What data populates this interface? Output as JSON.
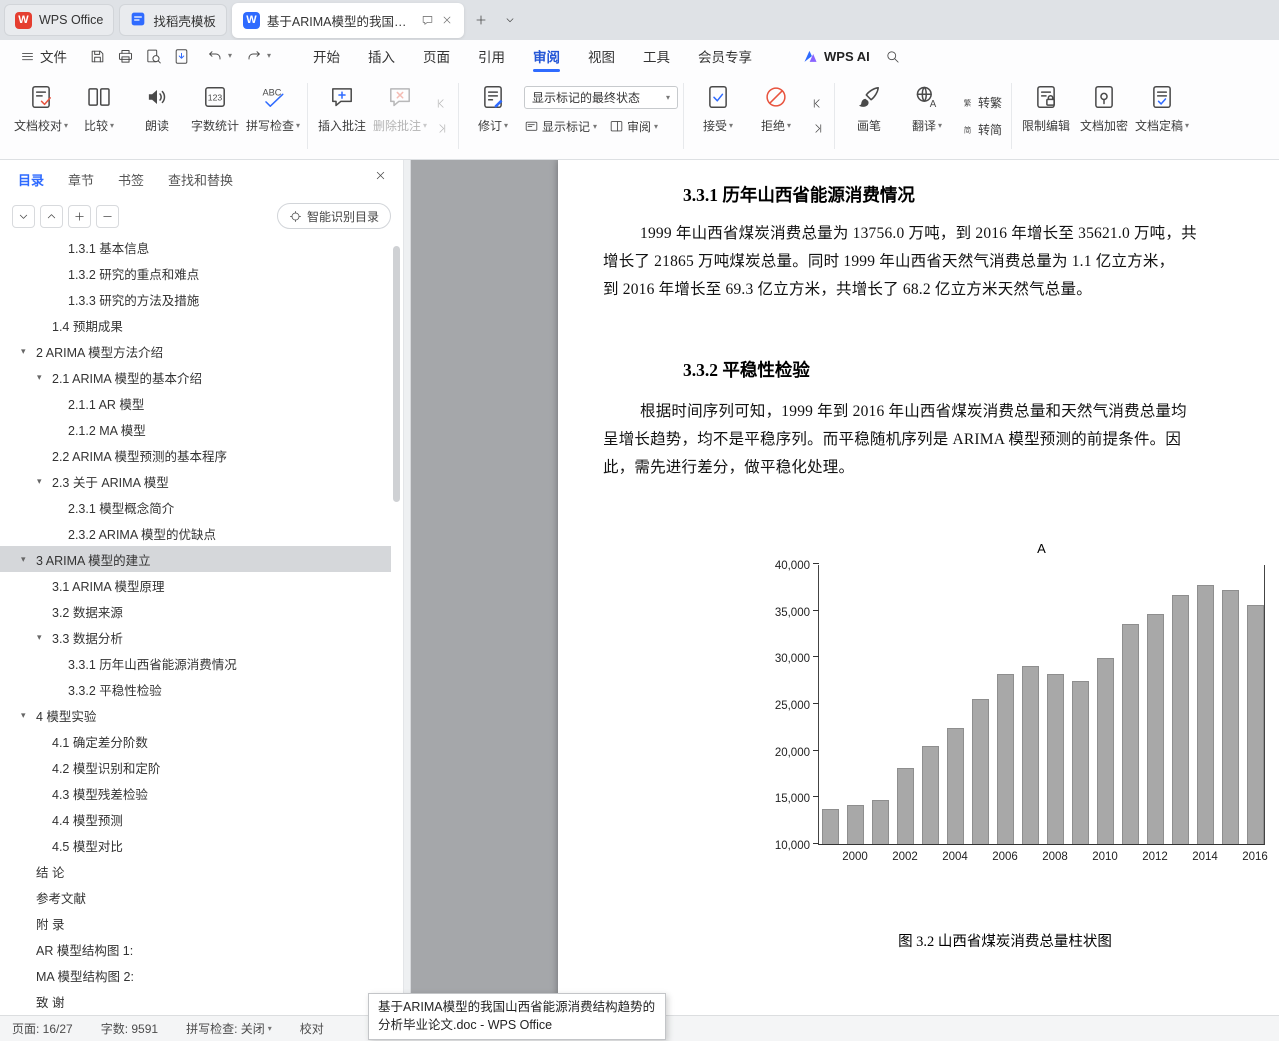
{
  "tabbar": {
    "wps_tab_label": "WPS Office",
    "tabs": [
      {
        "name": "template-store",
        "label": "找稻壳模板",
        "active": false
      },
      {
        "name": "arima-doc",
        "label": "基于ARIMA模型的我国山西省...",
        "active": true
      }
    ]
  },
  "menubar": {
    "file_label": "文件",
    "menus": [
      {
        "name": "home",
        "label": "开始",
        "active": false
      },
      {
        "name": "insert",
        "label": "插入",
        "active": false
      },
      {
        "name": "page",
        "label": "页面",
        "active": false
      },
      {
        "name": "reference",
        "label": "引用",
        "active": false
      },
      {
        "name": "review",
        "label": "审阅",
        "active": true
      },
      {
        "name": "view",
        "label": "视图",
        "active": false
      },
      {
        "name": "tools",
        "label": "工具",
        "active": false
      },
      {
        "name": "membership",
        "label": "会员专享",
        "active": false
      }
    ],
    "wps_ai_label": "WPS AI"
  },
  "ribbon": {
    "markup_state_value": "显示标记的最终状态",
    "groups": [
      {
        "items": [
          {
            "kind": "large",
            "name": "doc-proofing",
            "icon": "doc-check-icon",
            "label": "文档校对",
            "dropdown": true
          },
          {
            "kind": "large",
            "name": "compare",
            "icon": "compare-icon",
            "label": "比较",
            "dropdown": true
          },
          {
            "kind": "large",
            "name": "read-aloud",
            "icon": "speaker-icon",
            "label": "朗读",
            "dropdown": false
          },
          {
            "kind": "large",
            "name": "word-count",
            "icon": "word-count-icon",
            "label": "字数统计",
            "dropdown": false
          },
          {
            "kind": "large",
            "name": "spell-check",
            "icon": "spell-check-icon",
            "label": "拼写检查",
            "dropdown": true
          }
        ]
      },
      {
        "items": [
          {
            "kind": "large",
            "name": "insert-comment",
            "icon": "insert-comment-icon",
            "label": "插入批注",
            "dropdown": false
          },
          {
            "kind": "large",
            "name": "delete-comment",
            "icon": "delete-comment-icon",
            "label": "删除批注",
            "dropdown": true,
            "disabled": true
          },
          {
            "kind": "nav",
            "name": "comment-nav",
            "disabled": true
          }
        ]
      },
      {
        "items": [
          {
            "kind": "large",
            "name": "track-changes",
            "icon": "track-changes-icon",
            "label": "修订",
            "dropdown": true
          },
          {
            "kind": "markup-stack",
            "name": "markup-controls",
            "buttons": [
              {
                "name": "show-markup",
                "icon": "show-markup-icon",
                "label": "显示标记",
                "dropdown": true
              },
              {
                "name": "review-pane",
                "icon": "review-pane-icon",
                "label": "审阅",
                "dropdown": true
              }
            ]
          }
        ]
      },
      {
        "items": [
          {
            "kind": "large",
            "name": "accept-changes",
            "icon": "accept-icon",
            "label": "接受",
            "dropdown": true
          },
          {
            "kind": "large",
            "name": "reject-changes",
            "icon": "reject-icon",
            "label": "拒绝",
            "dropdown": true
          },
          {
            "kind": "nav",
            "name": "change-nav",
            "disabled": false
          }
        ]
      },
      {
        "items": [
          {
            "kind": "large",
            "name": "ink-brush",
            "icon": "brush-icon",
            "label": "画笔",
            "dropdown": false
          },
          {
            "kind": "large",
            "name": "translate",
            "icon": "translate-icon",
            "label": "翻译",
            "dropdown": true
          },
          {
            "kind": "small-stack",
            "name": "convert-stack",
            "buttons": [
              {
                "name": "to-traditional",
                "icon": "to-traditional-icon",
                "label": "转繁"
              },
              {
                "name": "to-simplified",
                "icon": "to-simplified-icon",
                "label": "转简"
              }
            ]
          }
        ]
      },
      {
        "items": [
          {
            "kind": "large",
            "name": "restrict-editing",
            "icon": "restrict-edit-icon",
            "label": "限制编辑",
            "dropdown": false
          },
          {
            "kind": "large",
            "name": "encrypt-document",
            "icon": "encrypt-icon",
            "label": "文档加密",
            "dropdown": false
          },
          {
            "kind": "large",
            "name": "finalize-document",
            "icon": "finalize-icon",
            "label": "文档定稿",
            "dropdown": true
          }
        ]
      }
    ]
  },
  "sidebar": {
    "tabs": [
      {
        "name": "toc",
        "label": "目录",
        "active": true
      },
      {
        "name": "chapters",
        "label": "章节",
        "active": false
      },
      {
        "name": "bookmarks",
        "label": "书签",
        "active": false
      },
      {
        "name": "find-replace",
        "label": "查找和替换",
        "active": false
      }
    ],
    "smart_toc_label": "智能识别目录",
    "toc": [
      {
        "text": "1.3.1 基本信息",
        "level": 3
      },
      {
        "text": "1.3.2 研究的重点和难点",
        "level": 3
      },
      {
        "text": "1.3.3 研究的方法及措施",
        "level": 3
      },
      {
        "text": "1.4 预期成果",
        "level": 2
      },
      {
        "text": "2 ARIMA 模型方法介绍",
        "level": 1,
        "expand": true
      },
      {
        "text": "2.1 ARIMA 模型的基本介绍",
        "level": 2,
        "expand": true
      },
      {
        "text": "2.1.1 AR 模型",
        "level": 3
      },
      {
        "text": "2.1.2 MA 模型",
        "level": 3
      },
      {
        "text": "2.2 ARIMA 模型预测的基本程序",
        "level": 2
      },
      {
        "text": "2.3 关于 ARIMA 模型",
        "level": 2,
        "expand": true
      },
      {
        "text": "2.3.1 模型概念简介",
        "level": 3
      },
      {
        "text": "2.3.2 ARIMA 模型的优缺点",
        "level": 3
      },
      {
        "text": "3 ARIMA 模型的建立",
        "level": 1,
        "expand": true,
        "selected": true
      },
      {
        "text": "3.1 ARIMA 模型原理",
        "level": 2
      },
      {
        "text": "3.2 数据来源",
        "level": 2
      },
      {
        "text": "3.3 数据分析",
        "level": 2,
        "expand": true
      },
      {
        "text": "3.3.1 历年山西省能源消费情况",
        "level": 3
      },
      {
        "text": "3.3.2 平稳性检验",
        "level": 3
      },
      {
        "text": "4 模型实验",
        "level": 1,
        "expand": true
      },
      {
        "text": "4.1 确定差分阶数",
        "level": 2
      },
      {
        "text": "4.2 模型识别和定阶",
        "level": 2
      },
      {
        "text": "4.3 模型残差检验",
        "level": 2
      },
      {
        "text": "4.4 模型预测",
        "level": 2
      },
      {
        "text": "4.5 模型对比",
        "level": 2
      },
      {
        "text": "结 论",
        "level": 1
      },
      {
        "text": "参考文献",
        "level": 1
      },
      {
        "text": "附 录",
        "level": 1
      },
      {
        "text": "AR 模型结构图 1:",
        "level": 1
      },
      {
        "text": "MA 模型结构图 2:",
        "level": 1
      },
      {
        "text": "致 谢",
        "level": 1
      }
    ]
  },
  "document": {
    "sections": [
      {
        "heading": "3.3.1  历年山西省能源消费情况",
        "lines": [
          "1999 年山西省煤炭消费总量为 13756.0 万吨，到 2016 年增长至 35621.0 万吨，共",
          "增长了 21865 万吨煤炭总量。同时 1999 年山西省天然气消费总量为 1.1 亿立方米，",
          "到 2016 年增长至 69.3 亿立方米，共增长了 68.2 亿立方米天然气总量。"
        ]
      },
      {
        "heading": "3.3.2  平稳性检验",
        "lines": [
          "根据时间序列可知，1999 年到 2016 年山西省煤炭消费总量和天然气消费总量均",
          "呈增长趋势，均不是平稳序列。而平稳随机序列是 ARIMA 模型预测的前提条件。因",
          "此，需先进行差分，做平稳化处理。"
        ]
      }
    ],
    "figure_caption": "图 3.2 山西省煤炭消费总量柱状图"
  },
  "chart_data": {
    "type": "bar",
    "title": "A",
    "categories": [
      1999,
      2000,
      2001,
      2002,
      2003,
      2004,
      2005,
      2006,
      2007,
      2008,
      2009,
      2010,
      2011,
      2012,
      2013,
      2014,
      2015,
      2016
    ],
    "values": [
      13756,
      14200,
      14750,
      18100,
      20450,
      22400,
      25500,
      28200,
      29100,
      28200,
      27500,
      29900,
      33600,
      34600,
      36700,
      37750,
      37200,
      35621
    ],
    "ylim": [
      10000,
      40000
    ],
    "ytick_step": 5000,
    "xtick_labels": [
      "2000",
      "2002",
      "2004",
      "2006",
      "2008",
      "2010",
      "2012",
      "2014",
      "2016"
    ],
    "xlabel": "",
    "ylabel": "",
    "grid": false,
    "legend": false,
    "bar_color": "#a8a8a8",
    "caption": "图 3.2 山西省煤炭消费总量柱状图"
  },
  "statusbar": {
    "page": "页面: 16/27",
    "words": "字数: 9591",
    "spellcheck": "拼写检查: 关闭",
    "proofread": "校对"
  },
  "tooltip": "基于ARIMA模型的我国山西省能源消费结构趋势的分析毕业论文.doc - WPS Office"
}
